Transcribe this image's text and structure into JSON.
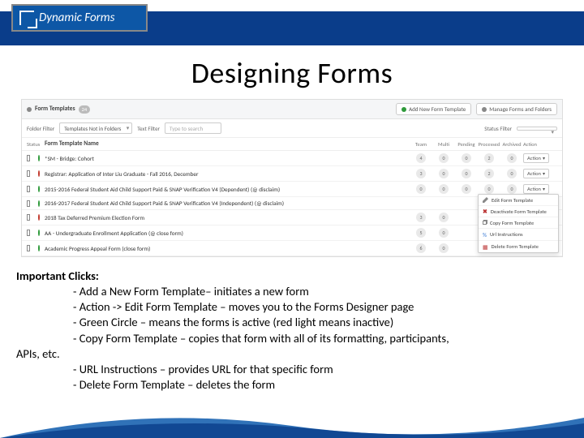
{
  "logo": {
    "text": "Dynamic Forms"
  },
  "title": "Designing Forms",
  "app": {
    "panelTitle": "Form Templates",
    "panelCount": "24",
    "btnAdd": "Add New Form Template",
    "btnManage": "Manage Forms and Folders",
    "filters": {
      "folderLabel": "Folder Filter",
      "folderValue": "Templates Not in Folders",
      "textLabel": "Text Filter",
      "textPlaceholder": "Type to search",
      "statusLabel": "Status Filter",
      "statusValue": ""
    },
    "headers": {
      "status": "Status",
      "name": "Form Template Name",
      "c1": "Team",
      "c2": "Multi",
      "c3": "Pending",
      "c4": "Processed",
      "c5": "Archived",
      "action": "Action"
    },
    "rows": [
      {
        "status": "#2e9a3a",
        "name": "*SM - Bridge: Cohort",
        "counts": [
          "4",
          "0",
          "0",
          "2",
          "0"
        ],
        "action": true,
        "menu": false
      },
      {
        "status": "#c23a2e",
        "name": "Registrar: Application of Inter Liu Graduate - Fall 2016, December",
        "counts": [
          "3",
          "0",
          "0",
          "2",
          "0"
        ],
        "action": true,
        "menu": false
      },
      {
        "status": "#2e9a3a",
        "name": "2015-2016 Federal Student Aid Child Support Paid & SNAP Verification V4 (Dependent) (@ disclaim)",
        "counts": [
          "0",
          "0",
          "0",
          "0",
          "0"
        ],
        "action": true,
        "menu": true
      },
      {
        "status": "#2e9a3a",
        "name": "2016-2017 Federal Student Aid Child Support Paid & SNAP Verification V4 (Independent) (@ disclaim)",
        "counts": [
          "",
          "",
          "",
          "",
          ""
        ],
        "action": false,
        "menu": false
      },
      {
        "status": "#c23a2e",
        "name": "2018 Tax Deferred Premium Election Form",
        "counts": [
          "3",
          "0",
          "",
          "",
          ""
        ],
        "action": false,
        "menu": false
      },
      {
        "status": "#2e9a3a",
        "name": "AA - Undergraduate Enrollment Application (@ close form)",
        "counts": [
          "5",
          "0",
          "",
          "",
          ""
        ],
        "action": false,
        "menu": false
      },
      {
        "status": "#2e9a3a",
        "name": "Academic Progress Appeal Form (close form)",
        "counts": [
          "6",
          "0",
          "",
          "",
          ""
        ],
        "action": false,
        "menu": false
      }
    ],
    "menu": {
      "edit": "Edit Form Template",
      "deactivate": "Deactivate Form Template",
      "copy": "Copy Form Template",
      "url": "Url Instructions",
      "delete": "Delete Form Template"
    }
  },
  "notes": {
    "heading": "Important Clicks:",
    "b1": "- Add a New Form Template– initiates a new form",
    "b2": "- Action -> Edit Form Template – moves you to the Forms Designer page",
    "b3": "- Green Circle – means the forms is active (red light means inactive)",
    "b4": "- Copy Form Template – copies that form with all of its formatting, participants,",
    "b4b": "APIs, etc.",
    "b5": "- URL Instructions – provides URL for that specific form",
    "b6": "- Delete Form Template – deletes the form"
  }
}
